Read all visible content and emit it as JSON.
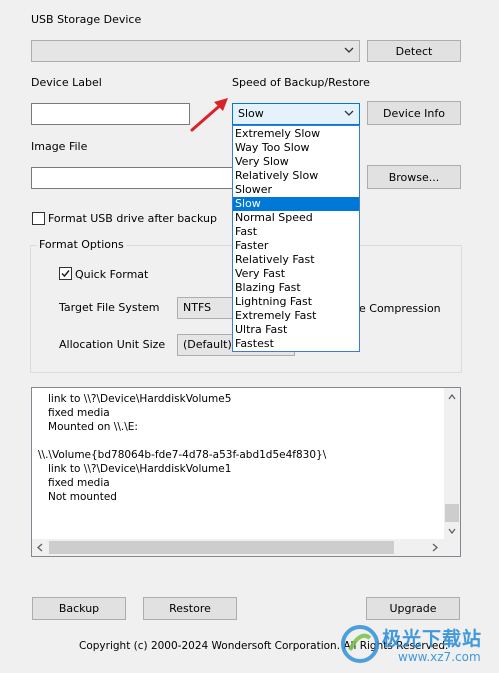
{
  "usb": {
    "label": "USB Storage Device",
    "value": "",
    "detect_label": "Detect"
  },
  "device_label": {
    "label": "Device Label",
    "value": ""
  },
  "speed": {
    "label": "Speed of Backup/Restore",
    "selected": "Slow",
    "device_info_label": "Device Info",
    "options": [
      "Extremely Slow",
      "Way Too Slow",
      "Very Slow",
      "Relatively Slow",
      "Slower",
      "Slow",
      "Normal Speed",
      "Fast",
      "Faster",
      "Relatively Fast",
      "Very Fast",
      "Blazing Fast",
      "Lightning Fast",
      "Extremely Fast",
      "Ultra Fast",
      "Fastest"
    ],
    "selected_index": 5
  },
  "image_file": {
    "label": "Image File",
    "value": "",
    "browse_label": "Browse..."
  },
  "format_usb": {
    "label": "Format USB drive after backup",
    "checked": false
  },
  "format_options": {
    "title": "Format Options",
    "quick_format_label": "Quick Format",
    "quick_format_checked": true,
    "fs_label": "Target File System",
    "fs_value": "NTFS",
    "compression_label_partial": "e Compression",
    "alloc_label": "Allocation Unit Size",
    "alloc_value": "(Default)"
  },
  "log": {
    "lines": [
      "   link to \\\\?\\Device\\HarddiskVolume5",
      "   fixed media",
      "   Mounted on \\\\.\\E:",
      "",
      "\\\\.\\Volume{bd78064b-fde7-4d78-a53f-abd1d5e4f830}\\",
      "   link to \\\\?\\Device\\HarddiskVolume1",
      "   fixed media",
      "   Not mounted"
    ]
  },
  "footer": {
    "backup_label": "Backup",
    "restore_label": "Restore",
    "upgrade_label": "Upgrade",
    "copyright": "Copyright (c) 2000-2024 Wondersoft Corporation. All Rights Reserved."
  },
  "watermark": {
    "site_cn": "极光下载站",
    "url": "www.xz7.com"
  },
  "colors": {
    "selection": "#0078d7",
    "arrow": "#d9232a"
  }
}
